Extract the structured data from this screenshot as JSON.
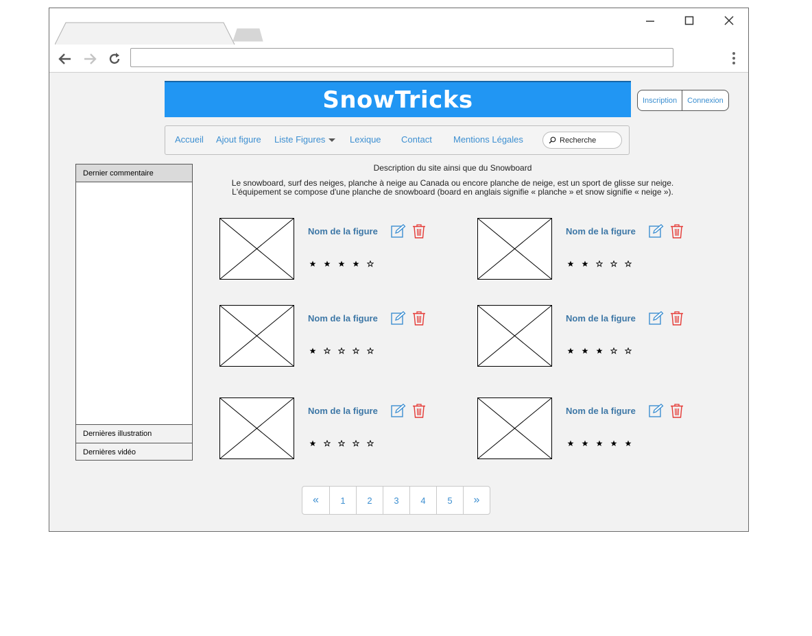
{
  "site": {
    "title": "SnowTricks",
    "auth": {
      "signup": "Inscription",
      "login": "Connexion"
    }
  },
  "nav": {
    "items": [
      "Accueil",
      "Ajout figure",
      "Liste Figures",
      "Lexique",
      "Contact",
      "Mentions Légales"
    ],
    "search_placeholder": "Recherche"
  },
  "sidebar": {
    "latest_comment": "Dernier commentaire",
    "latest_illustrations": "Dernières illustration",
    "latest_videos": "Dernières vidéo"
  },
  "description": {
    "title": "Description du site ainsi que du Snowboard",
    "line1": "Le snowboard, surf des neiges, planche à neige au Canada ou encore planche de neige, est un sport de glisse sur neige.",
    "line2": "L'équipement se compose d'une planche de snowboard (board en anglais signifie « planche » et snow signifie « neige »)."
  },
  "cards": [
    {
      "name": "Nom de la figure",
      "rating": 4
    },
    {
      "name": "Nom de la figure",
      "rating": 2
    },
    {
      "name": "Nom de la figure",
      "rating": 1
    },
    {
      "name": "Nom de la figure",
      "rating": 3
    },
    {
      "name": "Nom de la figure",
      "rating": 1
    },
    {
      "name": "Nom de la figure",
      "rating": 5
    }
  ],
  "rating_max": 5,
  "pagination": {
    "prev": "«",
    "pages": [
      "1",
      "2",
      "3",
      "4",
      "5"
    ],
    "next": "»"
  },
  "colors": {
    "brand": "#2196f3",
    "link": "#3d8fd1",
    "delete": "#e53935",
    "edit": "#3d8fd1"
  },
  "icons": {
    "edit": "edit-icon",
    "delete": "trash-icon",
    "search": "search-icon"
  }
}
